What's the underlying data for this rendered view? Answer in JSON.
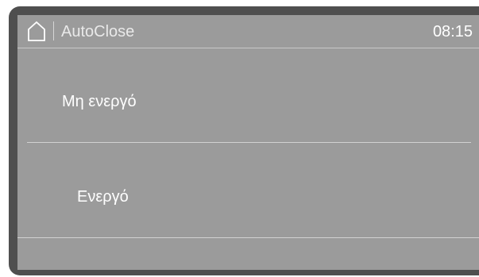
{
  "header": {
    "home_icon": "home-icon",
    "title": "AutoClose",
    "time": "08:15"
  },
  "options": [
    {
      "label": "Μη ενεργό"
    },
    {
      "label": "Ενεργό"
    }
  ],
  "colors": {
    "frame": "#4f4f4f",
    "screen": "#9b9b9b",
    "text": "#ffffff",
    "divider": "#d1d1d1"
  }
}
